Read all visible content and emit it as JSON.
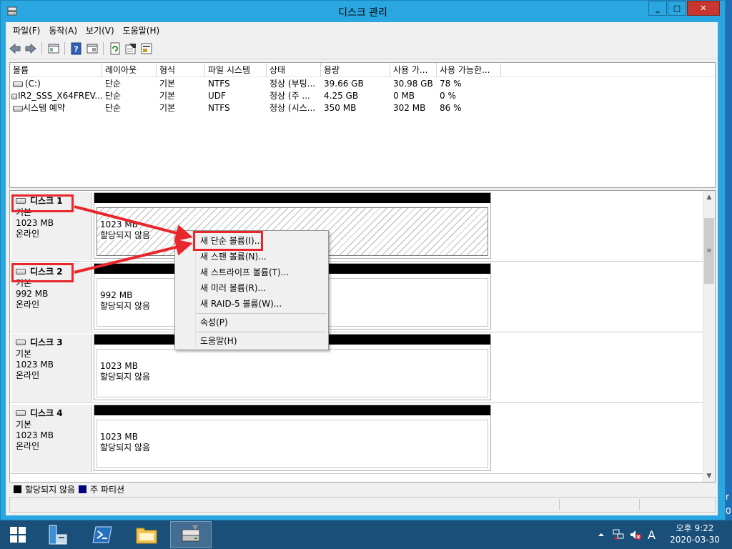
{
  "window": {
    "title": "디스크 관리",
    "buttons": {
      "minimize": "_",
      "maximize": "□",
      "close": "✕"
    }
  },
  "menubar": [
    "파일(F)",
    "동작(A)",
    "보기(V)",
    "도움말(H)"
  ],
  "toolbar": {
    "icons": [
      "back-icon",
      "forward-icon",
      "console-tree-icon",
      "help-icon",
      "help-topics-icon",
      "refresh-icon",
      "properties-icon",
      "export-icon"
    ]
  },
  "volume_list": {
    "columns": [
      "볼륨",
      "레이아웃",
      "형식",
      "파일 시스템",
      "상태",
      "용량",
      "사용 가...",
      "사용 가능한..."
    ],
    "rows": [
      [
        "(C:)",
        "단순",
        "기본",
        "NTFS",
        "정상 (부팅...",
        "39.66 GB",
        "30.98 GB",
        "78 %"
      ],
      [
        "IR2_SSS_X64FREV...",
        "단순",
        "기본",
        "UDF",
        "정상 (주 ...",
        "4.25 GB",
        "0 MB",
        "0 %"
      ],
      [
        "시스템 예약",
        "단순",
        "기본",
        "NTFS",
        "정상 (시스...",
        "350 MB",
        "302 MB",
        "86 %"
      ]
    ]
  },
  "disks": [
    {
      "name": "디스크 1",
      "type": "기본",
      "size": "1023 MB",
      "status": "온라인",
      "partition_size": "1023 MB",
      "partition_status": "할당되지 않음"
    },
    {
      "name": "디스크 2",
      "type": "기본",
      "size": "992 MB",
      "status": "온라인",
      "partition_size": "992 MB",
      "partition_status": "할당되지 않음"
    },
    {
      "name": "디스크 3",
      "type": "기본",
      "size": "1023 MB",
      "status": "온라인",
      "partition_size": "1023 MB",
      "partition_status": "할당되지 않음"
    },
    {
      "name": "디스크 4",
      "type": "기본",
      "size": "1023 MB",
      "status": "온라인",
      "partition_size": "1023 MB",
      "partition_status": "할당되지 않음"
    }
  ],
  "legend": [
    {
      "label": "할당되지 않음",
      "color": "#000000"
    },
    {
      "label": "주 파티션",
      "color": "#00007f"
    }
  ],
  "context_menu": {
    "items": [
      "새 단순 볼륨(I)...",
      "새 스팬 볼륨(N)...",
      "새 스트라이프 볼륨(T)...",
      "새 미러 볼륨(R)...",
      "새 RAID-5 볼륨(W)...",
      "속성(P)",
      "도움말(H)"
    ]
  },
  "desktop_edge": {
    "text1": "r",
    "text2": "0"
  },
  "taskbar": {
    "tray": {
      "input_indicator": "A"
    },
    "clock": {
      "time": "오후 9:22",
      "date": "2020-03-30"
    }
  },
  "colors": {
    "titlebar": "#2aa7e0",
    "close": "#c7372f",
    "annotation": "#e8262b",
    "taskbar": "#1a4f7a"
  }
}
